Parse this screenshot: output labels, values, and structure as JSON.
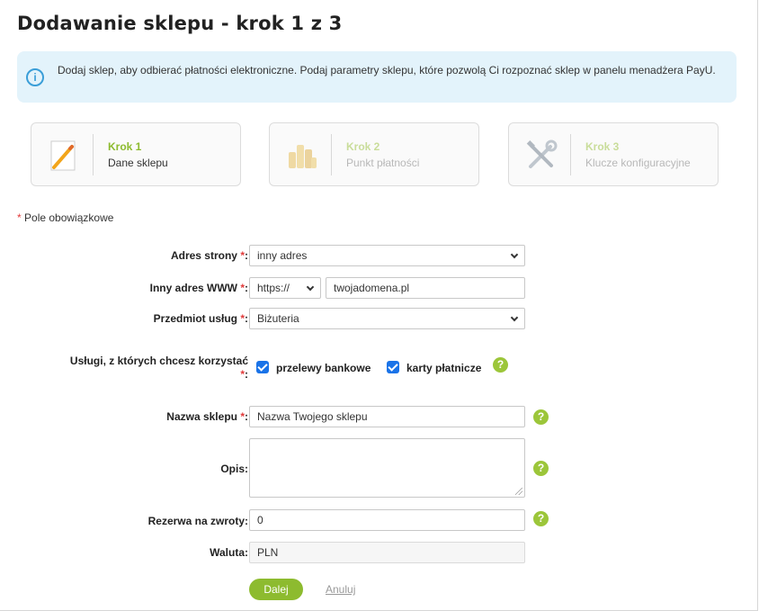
{
  "page": {
    "title": "Dodawanie sklepu - krok 1 z 3",
    "info_text": "Dodaj sklep, aby odbierać płatności elektroniczne. Podaj parametry sklepu, które pozwolą Ci rozpoznać sklep w panelu menadżera PayU."
  },
  "steps": [
    {
      "number": "Krok 1",
      "label": "Dane sklepu",
      "icon": "pencil-icon",
      "active": true
    },
    {
      "number": "Krok 2",
      "label": "Punkt płatności",
      "icon": "coins-icon",
      "active": false
    },
    {
      "number": "Krok 3",
      "label": "Klucze konfiguracyjne",
      "icon": "tools-icon",
      "active": false
    }
  ],
  "form": {
    "required_note": "Pole obowiązkowe",
    "required_mark": "*",
    "address_label": "Adres strony",
    "address_value": "inny adres",
    "other_www_label": "Inny adres WWW",
    "protocol_value": "https://",
    "domain_value": "twojadomena.pl",
    "subject_label": "Przedmiot usług",
    "subject_value": "Biżuteria",
    "services_label": "Usługi, z których chcesz korzystać",
    "services": [
      {
        "label": "przelewy bankowe",
        "checked": true
      },
      {
        "label": "karty płatnicze",
        "checked": true
      }
    ],
    "shop_name_label": "Nazwa sklepu",
    "shop_name_value": "Nazwa Twojego sklepu",
    "description_label": "Opis",
    "description_value": "",
    "reserve_label": "Rezerwa na zwroty",
    "reserve_value": "0",
    "currency_label": "Waluta",
    "currency_value": "PLN",
    "colon": ":",
    "help_glyph": "?"
  },
  "actions": {
    "next_label": "Dalej",
    "cancel_label": "Anuluj"
  },
  "colors": {
    "accent_green": "#8dbb2f",
    "info_background": "#e3f3fb",
    "checkbox_blue": "#1a73e8",
    "required_red": "#e23b3b"
  }
}
